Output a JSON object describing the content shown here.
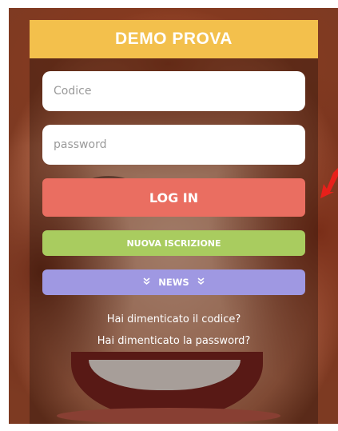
{
  "header": {
    "title": "DEMO PROVA"
  },
  "login_form": {
    "code_placeholder": "Codice",
    "password_placeholder": "password",
    "login_label": "LOG IN",
    "signup_label": "NUOVA ISCRIZIONE",
    "news_label": "NEWS",
    "news_left_chevron": "»",
    "news_right_chevron": "»"
  },
  "links": {
    "forgot_code": "Hai dimenticato il codice?",
    "forgot_password": "Hai dimenticato la password?"
  },
  "colors": {
    "header": "#f3c04c",
    "login_button": "#ea6e61",
    "signup_button": "#a9cc5f",
    "news_button": "#9f98e2",
    "annotation_arrow": "#e8201a"
  },
  "icons": {
    "annotation": "red-arrow-icon",
    "news": "double-chevron-down-icon"
  }
}
